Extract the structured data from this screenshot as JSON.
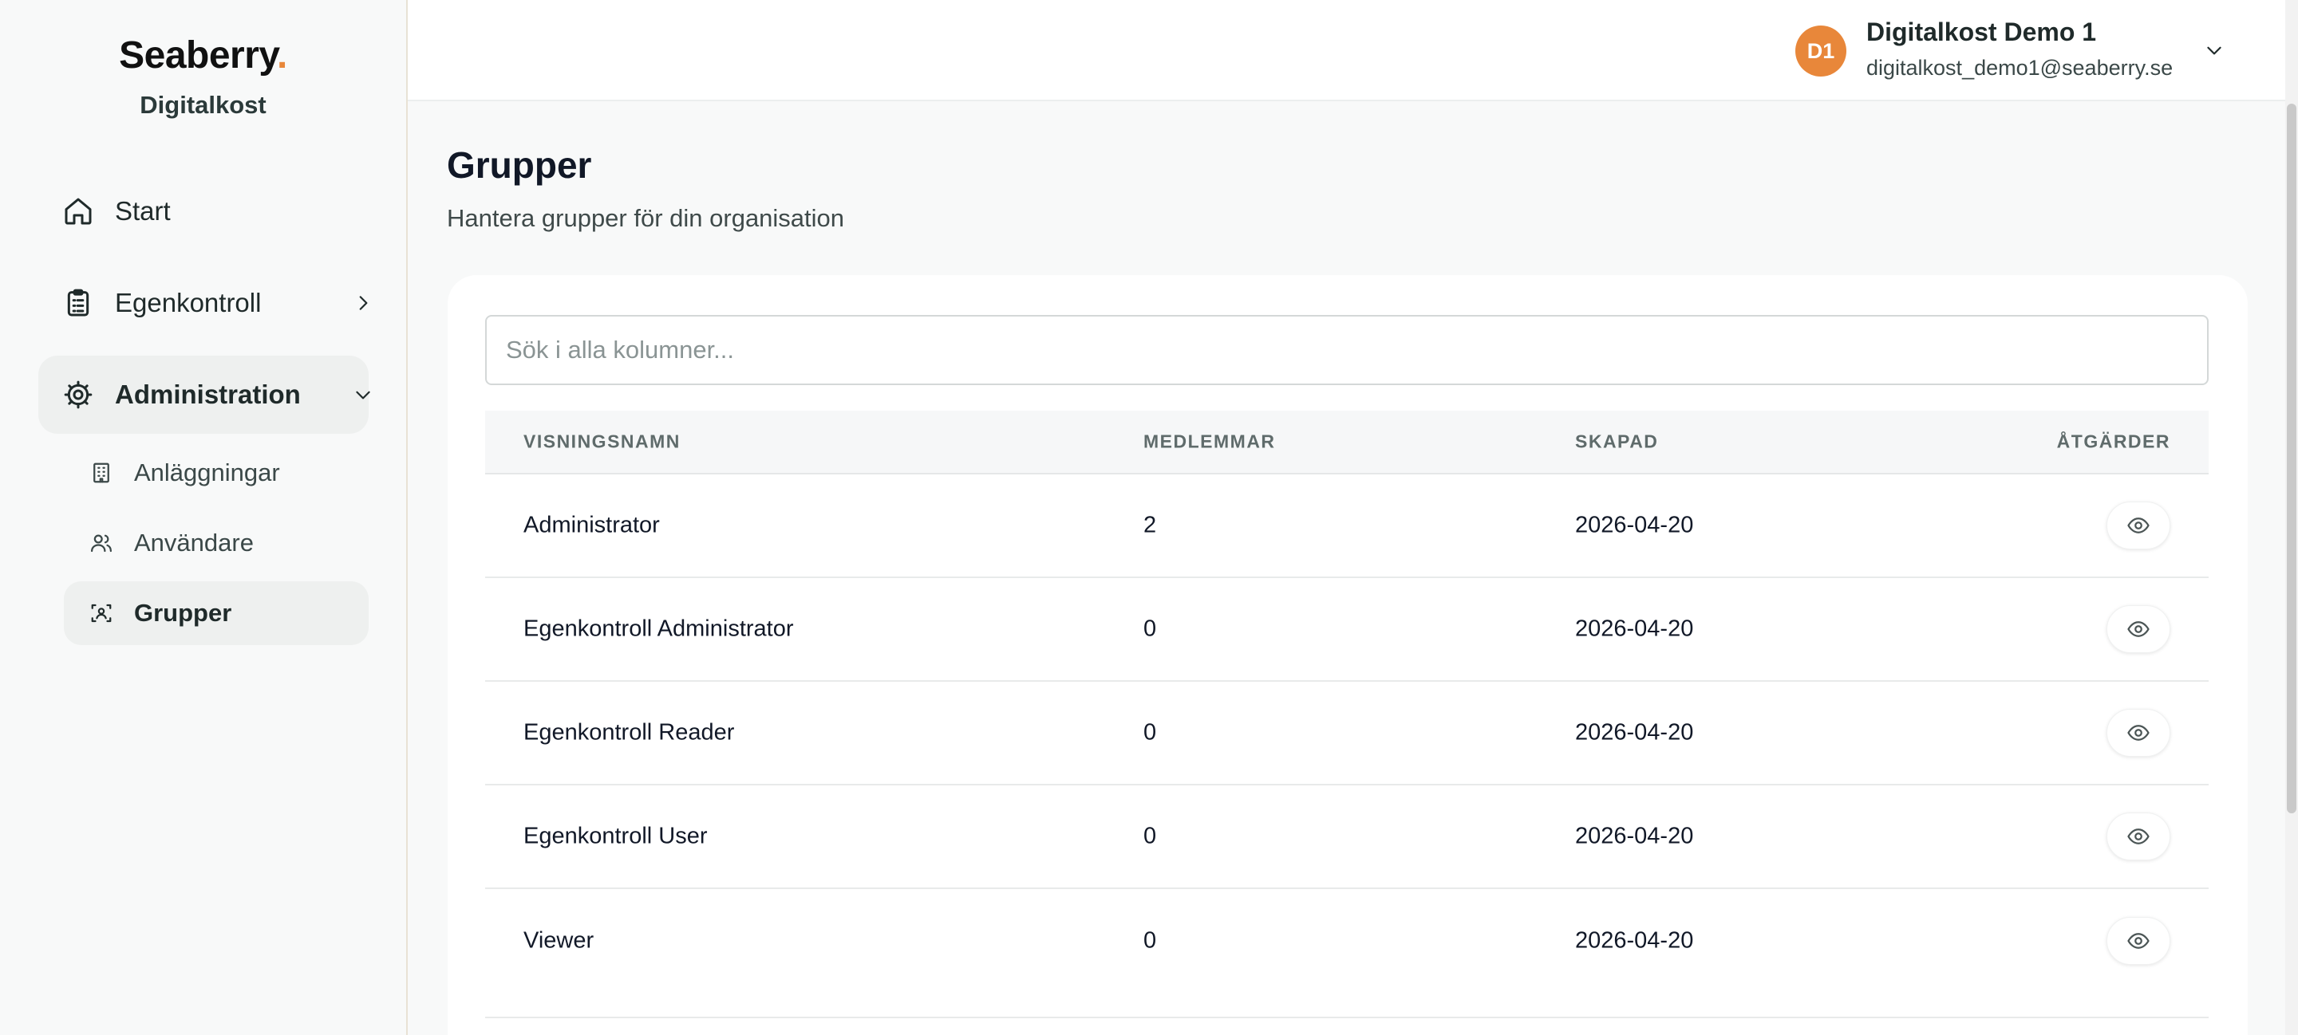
{
  "brand": {
    "name": "Seaberry",
    "dot": ".",
    "org": "Digitalkost"
  },
  "sidebar": {
    "items": [
      {
        "label": "Start",
        "icon": "home-icon"
      },
      {
        "label": "Egenkontroll",
        "icon": "clipboard-icon",
        "expanded": false
      },
      {
        "label": "Administration",
        "icon": "gear-icon",
        "expanded": true
      }
    ],
    "admin_subitems": [
      {
        "label": "Anläggningar",
        "icon": "building-icon"
      },
      {
        "label": "Användare",
        "icon": "users-icon"
      },
      {
        "label": "Grupper",
        "icon": "group-icon",
        "active": true
      }
    ]
  },
  "header": {
    "avatar_initials": "D1",
    "user_name": "Digitalkost Demo 1",
    "user_email": "digitalkost_demo1@seaberry.se"
  },
  "main": {
    "title": "Grupper",
    "subtitle": "Hantera grupper för din organisation",
    "search": {
      "placeholder": "Sök i alla kolumner...",
      "value": ""
    },
    "table": {
      "columns": [
        "VISNINGSNAMN",
        "MEDLEMMAR",
        "SKAPAD",
        "ÅTGÄRDER"
      ],
      "rows": [
        {
          "name": "Administrator",
          "members": "2",
          "created": "2026-04-20"
        },
        {
          "name": "Egenkontroll Administrator",
          "members": "0",
          "created": "2026-04-20"
        },
        {
          "name": "Egenkontroll Reader",
          "members": "0",
          "created": "2026-04-20"
        },
        {
          "name": "Egenkontroll User",
          "members": "0",
          "created": "2026-04-20"
        },
        {
          "name": "Viewer",
          "members": "0",
          "created": "2026-04-20"
        }
      ]
    }
  },
  "colors": {
    "accent": "#e8873a",
    "active_bg": "#eef0ef",
    "text_primary": "#111827"
  }
}
